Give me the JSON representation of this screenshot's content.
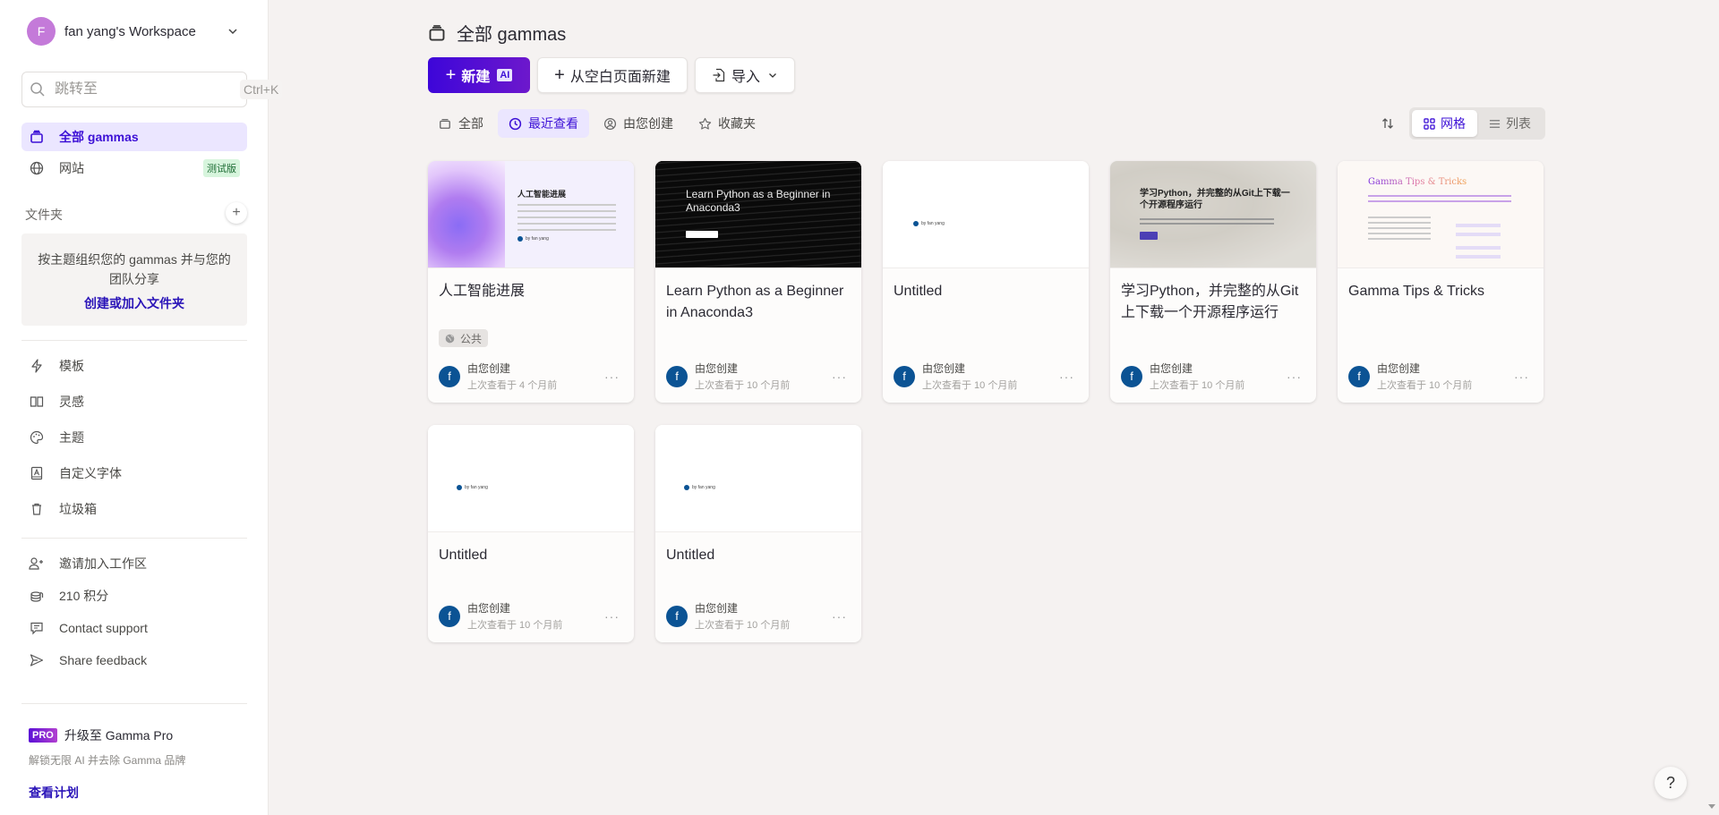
{
  "workspace": {
    "avatar_letter": "F",
    "name": "fan yang's Workspace"
  },
  "search": {
    "placeholder": "跳转至",
    "shortcut": "Ctrl+K"
  },
  "nav": [
    {
      "label": "全部 gammas",
      "icon": "stack-icon",
      "active": true
    },
    {
      "label": "网站",
      "icon": "globe-icon",
      "badge": "测试版"
    }
  ],
  "folders": {
    "title": "文件夹",
    "empty_text": "按主题组织您的 gammas 并与您的团队分享",
    "link": "创建或加入文件夹"
  },
  "tools": [
    {
      "label": "模板",
      "icon": "bolt-icon"
    },
    {
      "label": "灵感",
      "icon": "book-icon"
    },
    {
      "label": "主题",
      "icon": "palette-icon"
    },
    {
      "label": "自定义字体",
      "icon": "font-icon"
    },
    {
      "label": "垃圾箱",
      "icon": "trash-icon"
    }
  ],
  "account": [
    {
      "label": "邀请加入工作区",
      "icon": "user-plus-icon"
    },
    {
      "label": "210 积分",
      "icon": "coins-icon"
    },
    {
      "label": "Contact support",
      "icon": "chat-icon"
    },
    {
      "label": "Share feedback",
      "icon": "send-icon"
    }
  ],
  "pro": {
    "badge": "PRO",
    "title": "升级至 Gamma Pro",
    "subtitle": "解锁无限 AI 并去除 Gamma 品牌",
    "link": "查看计划"
  },
  "header": {
    "title": "全部 gammas",
    "new_label": "新建",
    "new_ai_badge": "AI",
    "blank_label": "从空白页面新建",
    "import_label": "导入"
  },
  "filters": [
    {
      "label": "全部",
      "icon": "stack-icon"
    },
    {
      "label": "最近查看",
      "icon": "clock-icon",
      "active": true
    },
    {
      "label": "由您创建",
      "icon": "user-circle-icon"
    },
    {
      "label": "收藏夹",
      "icon": "star-icon"
    }
  ],
  "view_toggle": {
    "grid": "网格",
    "list": "列表",
    "selected": "网格"
  },
  "cards": [
    {
      "title": "人工智能进展",
      "public_label": "公共",
      "by": "由您创建",
      "viewed": "上次查看于 4 个月前",
      "thumb_title": "人工智能进展",
      "avatar": "f"
    },
    {
      "title": "Learn Python as a Beginner in Anaconda3",
      "by": "由您创建",
      "viewed": "上次查看于 10 个月前",
      "thumb_title": "Learn Python as a Beginner in Anaconda3",
      "avatar": "f"
    },
    {
      "title": "Untitled",
      "by": "由您创建",
      "viewed": "上次查看于 10 个月前",
      "thumb_byline": "by fan yang",
      "avatar": "f"
    },
    {
      "title": "学习Python，并完整的从Git上下载一个开源程序运行",
      "by": "由您创建",
      "viewed": "上次查看于 10 个月前",
      "thumb_title": "学习Python，并完整的从Git上下载一个开源程序运行",
      "avatar": "f"
    },
    {
      "title": "Gamma Tips & Tricks",
      "by": "由您创建",
      "viewed": "上次查看于 10 个月前",
      "thumb_title": "Gamma Tips & Tricks",
      "avatar": "f"
    },
    {
      "title": "Untitled",
      "by": "由您创建",
      "viewed": "上次查看于 10 个月前",
      "thumb_byline": "by fan yang",
      "avatar": "f"
    },
    {
      "title": "Untitled",
      "by": "由您创建",
      "viewed": "上次查看于 10 个月前",
      "thumb_byline": "by fan yang",
      "avatar": "f"
    }
  ],
  "help_label": "?",
  "colors": {
    "accent": "#3d11d6",
    "active_bg": "#ebe6ff",
    "avatar": "#0b5394"
  }
}
